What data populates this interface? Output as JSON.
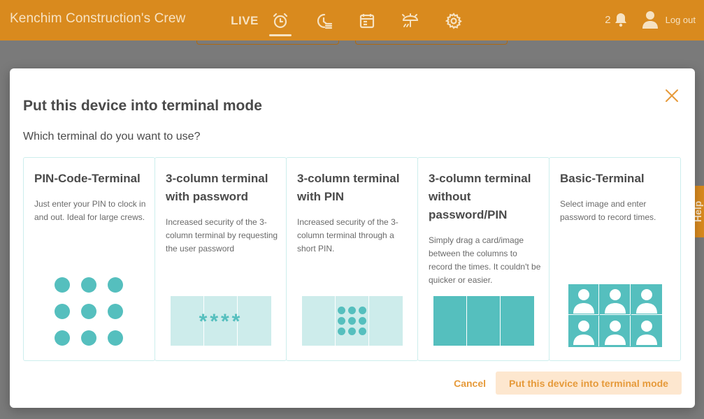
{
  "app": {
    "title": "Kenchim Construction's Crew",
    "nav_live_label": "LIVE",
    "notification_count": "2",
    "logout_label": "Log out",
    "help_label": "Help"
  },
  "colors": {
    "topbar": "#d98a1e",
    "accent": "#e69a3a",
    "teal": "#55bfbe",
    "teal_light": "#cdeceb"
  },
  "modal": {
    "title": "Put this device into terminal mode",
    "question": "Which terminal do you want to use?",
    "cancel_label": "Cancel",
    "confirm_label": "Put this device into terminal mode",
    "cards": [
      {
        "title": "PIN-Code-Terminal",
        "description": "Just enter your PIN to clock in and out. Ideal for large crews.",
        "icon": "dot-keypad-illustration"
      },
      {
        "title": "3-column terminal with password",
        "description": "Increased security of the 3-column terminal by requesting the user password",
        "icon": "password-columns-illustration",
        "password_mask": "****"
      },
      {
        "title": "3-column terminal with PIN",
        "description": "Increased security of the 3-column terminal through a short PIN.",
        "icon": "pin-columns-illustration"
      },
      {
        "title": "3-column terminal without password/PIN",
        "description": "Simply drag a card/image between the columns to record the times. It couldn't be quicker or easier.",
        "icon": "plain-columns-illustration"
      },
      {
        "title": "Basic-Terminal",
        "description": "Select image and enter password to record times.",
        "icon": "avatar-grid-illustration"
      }
    ]
  }
}
